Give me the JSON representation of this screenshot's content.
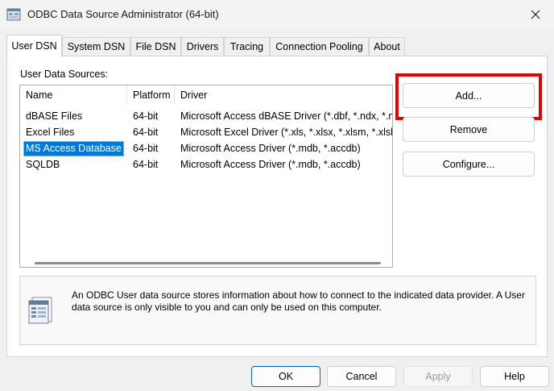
{
  "window": {
    "title": "ODBC Data Source Administrator (64-bit)"
  },
  "tabs": [
    "User DSN",
    "System DSN",
    "File DSN",
    "Drivers",
    "Tracing",
    "Connection Pooling",
    "About"
  ],
  "user_dsn": {
    "list_label": "User Data Sources:",
    "columns": [
      "Name",
      "Platform",
      "Driver"
    ],
    "rows": [
      {
        "name": "dBASE Files",
        "platform": "64-bit",
        "driver": "Microsoft Access dBASE Driver (*.dbf, *.ndx, *.m"
      },
      {
        "name": "Excel Files",
        "platform": "64-bit",
        "driver": "Microsoft Excel Driver (*.xls, *.xlsx, *.xlsm, *.xlsb)"
      },
      {
        "name": "MS Access Database",
        "platform": "64-bit",
        "driver": "Microsoft Access Driver (*.mdb, *.accdb)"
      },
      {
        "name": "SQLDB",
        "platform": "64-bit",
        "driver": "Microsoft Access Driver (*.mdb, *.accdb)"
      }
    ],
    "buttons": {
      "add": "Add...",
      "remove": "Remove",
      "configure": "Configure..."
    },
    "info_text": "An ODBC User data source stores information about how to connect to the indicated data provider.  A User data source is only visible to you and can only be used on this computer."
  },
  "footer_buttons": {
    "ok": "OK",
    "cancel": "Cancel",
    "apply": "Apply",
    "help": "Help"
  },
  "colors": {
    "selection": "#0078d7",
    "highlight": "#e60000",
    "default_button_border": "#0067c0"
  },
  "selected_row": "MS Access Database"
}
